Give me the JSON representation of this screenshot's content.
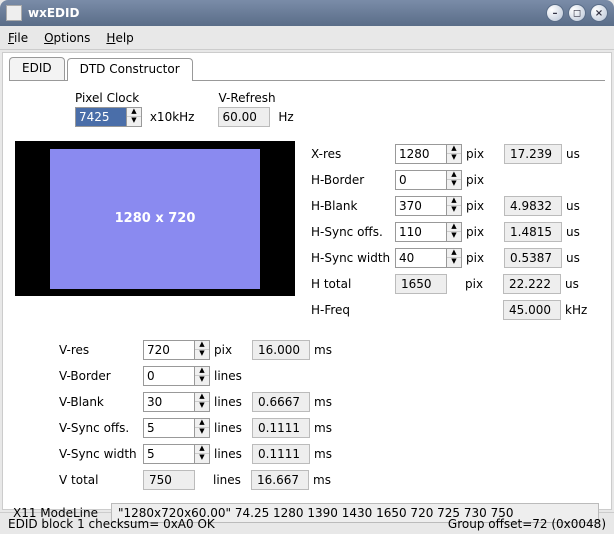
{
  "window": {
    "title": "wxEDID"
  },
  "menu": {
    "file": "File",
    "options": "Options",
    "help": "Help"
  },
  "tabs": {
    "edid": "EDID",
    "dtd": "DTD Constructor"
  },
  "top": {
    "pixel_clock_label": "Pixel Clock",
    "pixel_clock_value": "7425",
    "pixel_clock_unit": "x10kHz",
    "vrefresh_label": "V-Refresh",
    "vrefresh_value": "60.00",
    "vrefresh_unit": "Hz"
  },
  "preview": {
    "text": "1280 x 720"
  },
  "h": {
    "xres_label": "X-res",
    "xres": "1280",
    "xres_time": "17.239",
    "hborder_label": "H-Border",
    "hborder": "0",
    "hblank_label": "H-Blank",
    "hblank": "370",
    "hblank_time": "4.9832",
    "hsyncoffs_label": "H-Sync offs.",
    "hsyncoffs": "110",
    "hsyncoffs_time": "1.4815",
    "hsyncw_label": "H-Sync width",
    "hsyncw": "40",
    "hsyncw_time": "0.5387",
    "htotal_label": "H total",
    "htotal": "1650",
    "htotal_time": "22.222",
    "hfreq_label": "H-Freq",
    "hfreq": "45.000",
    "pix": "pix",
    "us": "us",
    "khz": "kHz"
  },
  "v": {
    "vres_label": "V-res",
    "vres": "720",
    "vres_time": "16.000",
    "vborder_label": "V-Border",
    "vborder": "0",
    "vblank_label": "V-Blank",
    "vblank": "30",
    "vblank_time": "0.6667",
    "vsyncoffs_label": "V-Sync offs.",
    "vsyncoffs": "5",
    "vsyncoffs_time": "0.1111",
    "vsyncw_label": "V-Sync width",
    "vsyncw": "5",
    "vsyncw_time": "0.1111",
    "vtotal_label": "V total",
    "vtotal": "750",
    "vtotal_time": "16.667",
    "lines": "lines",
    "ms": "ms",
    "pix": "pix"
  },
  "modeline": {
    "label": "X11 ModeLine",
    "value": "\"1280x720x60.00\" 74.25 1280 1390 1430 1650 720 725 730 750"
  },
  "status": {
    "left": "EDID block 1 checksum= 0xA0 OK",
    "right": "Group offset=72 (0x0048)"
  }
}
